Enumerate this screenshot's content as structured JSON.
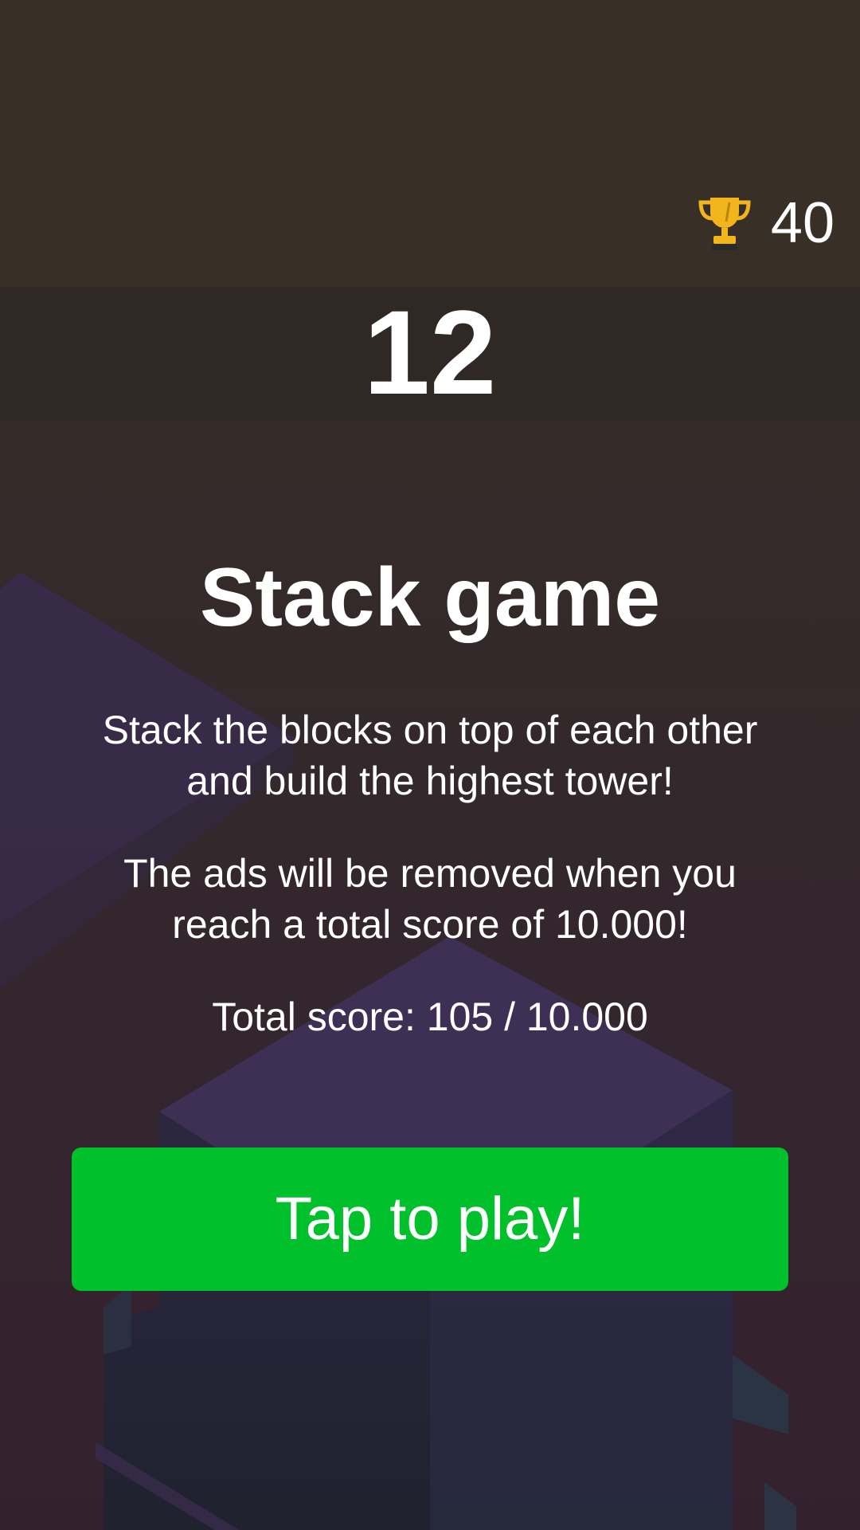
{
  "header": {
    "best_score": "40",
    "trophy_icon": "trophy-icon",
    "current_score": "12"
  },
  "menu": {
    "title": "Stack game",
    "description": "Stack the blocks on top of each other and build the highest tower!",
    "ads_notice": "The ads will be removed when you reach a total score of 10.000!",
    "total_score": "Total score: 105 / 10.000",
    "play_label": "Tap to play!"
  },
  "colors": {
    "play_button": "#00c12b",
    "trophy": "#f2b51c",
    "block_top": "#3e2f54",
    "block_left": "#24203a",
    "block_right": "#2b2544"
  }
}
